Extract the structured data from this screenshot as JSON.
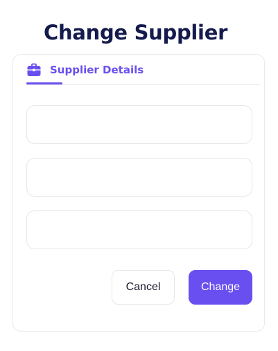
{
  "page": {
    "title": "Change Supplier"
  },
  "tabs": [
    {
      "label": "Supplier Details",
      "icon": "briefcase-icon",
      "active": true
    }
  ],
  "form": {
    "fields": [
      {
        "value": "",
        "placeholder": ""
      },
      {
        "value": "",
        "placeholder": ""
      },
      {
        "value": "",
        "placeholder": ""
      }
    ]
  },
  "actions": {
    "cancel_label": "Cancel",
    "submit_label": "Change"
  },
  "colors": {
    "accent": "#6a4ff0",
    "title": "#141b4d",
    "border": "#e6e6ec"
  }
}
